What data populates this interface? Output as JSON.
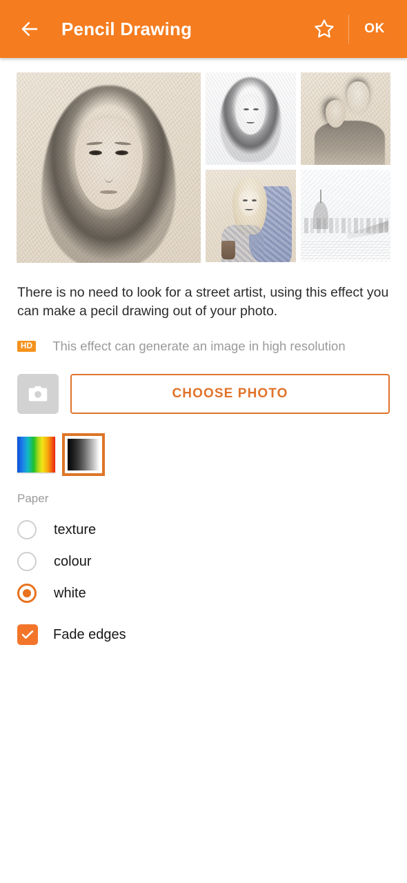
{
  "header": {
    "back_icon": "arrow-left-icon",
    "title": "Pencil Drawing",
    "favorite_icon": "star-outline-icon",
    "ok_label": "OK",
    "background_color": "#F57C1F",
    "text_color": "#FFFFFF"
  },
  "gallery": {
    "main": {
      "alt": "pencil-drawing-portrait-woman"
    },
    "thumbs": [
      {
        "alt": "pencil-drawing-smiling-woman"
      },
      {
        "alt": "pencil-drawing-couple-hugging"
      },
      {
        "alt": "pencil-drawing-blonde-woman-scarf"
      },
      {
        "alt": "pencil-drawing-city-skyline-bridge"
      }
    ]
  },
  "description": {
    "text": "There is no need to look for a street artist, using this effect you can make a pecil drawing out of your photo."
  },
  "hd_notice": {
    "badge": "HD",
    "text": "This effect can generate an image in high resolution",
    "badge_color": "#F5921E",
    "text_color": "#9A9A9A"
  },
  "actions": {
    "camera_icon": "camera-icon",
    "choose_photo_label": "CHOOSE PHOTO",
    "accent_color": "#E0732B"
  },
  "swatches": {
    "items": [
      {
        "name": "colour-swatch",
        "selected": false
      },
      {
        "name": "grayscale-swatch",
        "selected": true
      }
    ],
    "selected_border_color": "#DE7526"
  },
  "paper": {
    "label": "Paper",
    "options": [
      {
        "label": "texture",
        "selected": false
      },
      {
        "label": "colour",
        "selected": false
      },
      {
        "label": "white",
        "selected": true
      }
    ],
    "selected_color": "#E8721E"
  },
  "fade_edges": {
    "label": "Fade edges",
    "checked": true,
    "check_icon": "check-icon",
    "color": "#F2752A"
  }
}
